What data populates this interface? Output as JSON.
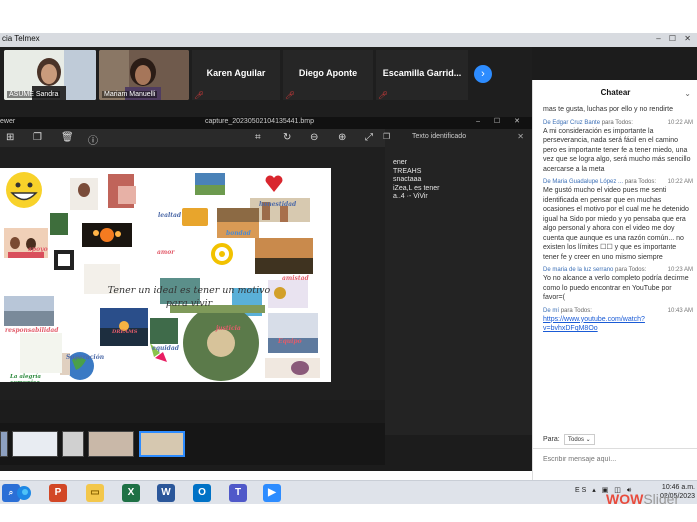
{
  "window": {
    "title": "cia Telmex",
    "controls": "– ☐ ✕"
  },
  "participants": [
    {
      "name": "ASUME Sandra"
    },
    {
      "name": "Mariam Manuelli"
    },
    {
      "name": "Karen Aguilar"
    },
    {
      "name": "Diego Aponte"
    },
    {
      "name": "Escamilla Garrid..."
    }
  ],
  "viewer": {
    "app_label": "ewer",
    "filename": "capture_20230502104135441.bmp",
    "window_controls": "– ☐ ✕",
    "text_panel_title": "Texto identificado",
    "ocr_lines": [
      "ener",
      "TREAHS",
      "snactaaa",
      "iZea,L es tener",
      "a..4 ·- ViVir"
    ]
  },
  "collage": {
    "phrase_line1": "Tener un ideal es tener un motivo",
    "phrase_line2": "para vivir",
    "words": {
      "lealtad": "lealtad",
      "honestidad": "honestidad",
      "apoyo": "apoyo",
      "bondad": "bondad",
      "amor": "amor",
      "amistad": "amistad",
      "responsabilidad": "responsabilidad",
      "justicia": "justicia",
      "equipo": "Equipo",
      "superacion": "Superación",
      "equidad": "equidad",
      "dreams": "DREAMS",
      "alegria": "La alegría comunica felicidad"
    }
  },
  "chat": {
    "title": "Chatear",
    "messages": [
      {
        "meta_from": "",
        "meta_to": "",
        "time": "",
        "text": "mas te gusta, luchas por ello y no rendirte"
      },
      {
        "meta_from": "De Edgar Cruz Bante",
        "meta_to": "para Todos:",
        "time": "10:22 AM",
        "text": "A mi consideración es importante la perseverancia, nada será fácil en el camino pero es importante tener fe a tener miedo, una vez que se logra algo, será mucho más sencillo acercarse a la meta"
      },
      {
        "meta_from": "De Maria Guadalupe López ...",
        "meta_to": "para Todos:",
        "time": "10:22 AM",
        "text": "Me gustó mucho el video pues me senti identificada en pensar que en muchas ocasiones el motivo por el cual me he detenido igual ha Sido por miedo y yo pensaba que era algo personal y ahora con el video me doy cuenta que aunque es una razón común... no existen los límites ☐☐ y que es importante tener fe y creer en uno mismo siempre"
      },
      {
        "meta_from": "De maria de la luz serrano",
        "meta_to": "para Todos:",
        "time": "10:23 AM",
        "text": "Yo no alcance a verlo completo podría decirme como lo puedo encontrar en YouTube por favor=("
      },
      {
        "meta_from": "De mí",
        "meta_to": "para Todos:",
        "time": "10:43 AM",
        "text": "",
        "link": "https://www.youtube.com/watch?v=bvhxDFqM8Oo"
      }
    ],
    "para_label": "Para:",
    "para_value": "Todos ⌄",
    "input_placeholder": "Escribir mensaje aquí..."
  },
  "taskbar": {
    "lang": "ES",
    "time": "10:46 a.m.",
    "date": "02/05/2023"
  },
  "watermark": {
    "main": "WOW",
    "rest": "Slider"
  },
  "colors": {
    "accent_blue": "#2d8cff",
    "mic_off": "#e03c3c",
    "link": "#1a5bd6"
  }
}
